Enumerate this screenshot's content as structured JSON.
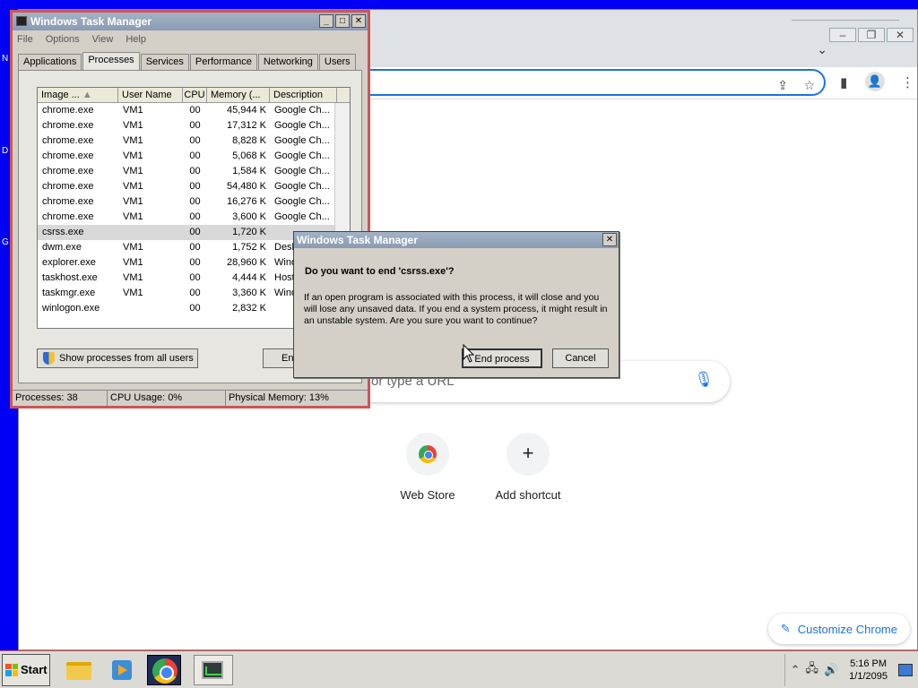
{
  "desktop": {
    "letters": [
      "N",
      "D",
      "G"
    ]
  },
  "chrome": {
    "search_placeholder": "or type a URL",
    "shortcuts": [
      {
        "label": "Web Store"
      },
      {
        "label": "Add shortcut"
      }
    ],
    "customize_label": "Customize Chrome",
    "tab_dropdown": "⌄",
    "window_controls": [
      "–",
      "❐",
      "✕"
    ],
    "colors": {
      "accent": "#1a73e8"
    }
  },
  "task_manager": {
    "title": "Windows Task Manager",
    "window_controls": [
      "_",
      "□",
      "✕"
    ],
    "menu": [
      "File",
      "Options",
      "View",
      "Help"
    ],
    "tabs": [
      "Applications",
      "Processes",
      "Services",
      "Performance",
      "Networking",
      "Users"
    ],
    "active_tab": "Processes",
    "columns": [
      "Image ...",
      "User Name",
      "CPU",
      "Memory (...",
      "Description"
    ],
    "processes": [
      {
        "image": "chrome.exe",
        "user": "VM1",
        "cpu": "00",
        "mem": "45,944 K",
        "desc": "Google Ch..."
      },
      {
        "image": "chrome.exe",
        "user": "VM1",
        "cpu": "00",
        "mem": "17,312 K",
        "desc": "Google Ch..."
      },
      {
        "image": "chrome.exe",
        "user": "VM1",
        "cpu": "00",
        "mem": "8,828 K",
        "desc": "Google Ch..."
      },
      {
        "image": "chrome.exe",
        "user": "VM1",
        "cpu": "00",
        "mem": "5,068 K",
        "desc": "Google Ch..."
      },
      {
        "image": "chrome.exe",
        "user": "VM1",
        "cpu": "00",
        "mem": "1,584 K",
        "desc": "Google Ch..."
      },
      {
        "image": "chrome.exe",
        "user": "VM1",
        "cpu": "00",
        "mem": "54,480 K",
        "desc": "Google Ch..."
      },
      {
        "image": "chrome.exe",
        "user": "VM1",
        "cpu": "00",
        "mem": "16,276 K",
        "desc": "Google Ch..."
      },
      {
        "image": "chrome.exe",
        "user": "VM1",
        "cpu": "00",
        "mem": "3,600 K",
        "desc": "Google Ch..."
      },
      {
        "image": "csrss.exe",
        "user": "",
        "cpu": "00",
        "mem": "1,720 K",
        "desc": ""
      },
      {
        "image": "dwm.exe",
        "user": "VM1",
        "cpu": "00",
        "mem": "1,752 K",
        "desc": "Desk"
      },
      {
        "image": "explorer.exe",
        "user": "VM1",
        "cpu": "00",
        "mem": "28,960 K",
        "desc": "Wind"
      },
      {
        "image": "taskhost.exe",
        "user": "VM1",
        "cpu": "00",
        "mem": "4,444 K",
        "desc": "Host"
      },
      {
        "image": "taskmgr.exe",
        "user": "VM1",
        "cpu": "00",
        "mem": "3,360 K",
        "desc": "Wind"
      },
      {
        "image": "winlogon.exe",
        "user": "",
        "cpu": "00",
        "mem": "2,832 K",
        "desc": ""
      }
    ],
    "selected_index": 8,
    "show_all_label": "Show processes from all users",
    "end_label": "End",
    "status": {
      "processes": "Processes: 38",
      "cpu": "CPU Usage: 0%",
      "memory": "Physical Memory: 13%"
    }
  },
  "dialog": {
    "title": "Windows Task Manager",
    "close": "✕",
    "question": "Do you want to end 'csrss.exe'?",
    "message": "If an open program is associated with this process, it will close and you will lose any unsaved data. If you end a system process, it might result in an unstable system. Are you sure you want to continue?",
    "end_process_label": "End process",
    "cancel_label": "Cancel"
  },
  "taskbar": {
    "start_label": "Start",
    "clock_time": "5:16 PM",
    "clock_date": "1/1/2095",
    "tray_glyphs": {
      "chevron": "⌃",
      "network": "🖧",
      "volume": "🔊"
    }
  }
}
